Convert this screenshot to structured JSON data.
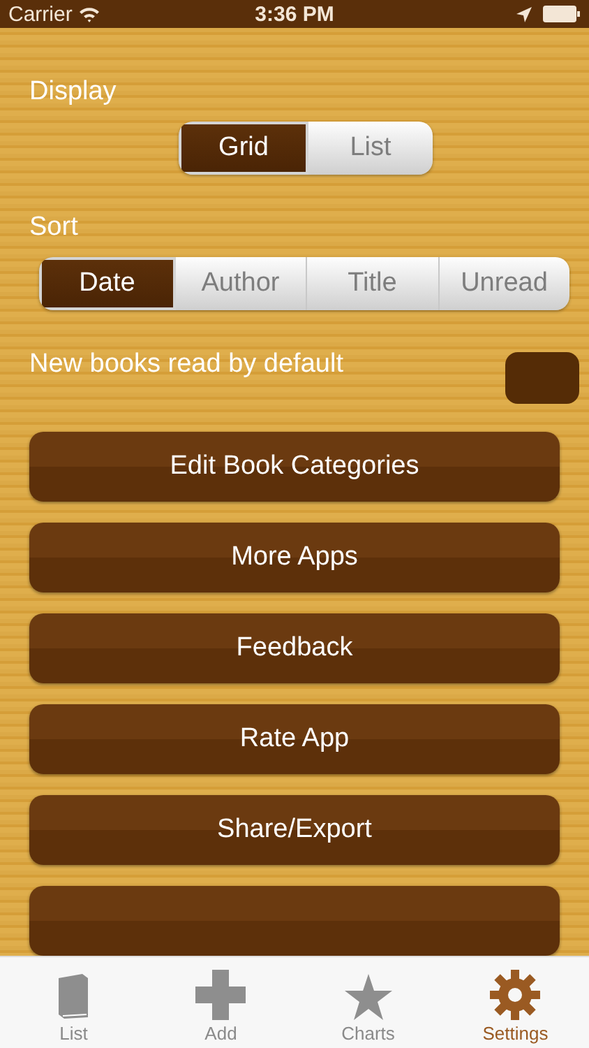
{
  "status_bar": {
    "carrier": "Carrier",
    "time": "3:36 PM"
  },
  "display": {
    "label": "Display",
    "options": [
      {
        "label": "Grid",
        "selected": true
      },
      {
        "label": "List",
        "selected": false
      }
    ]
  },
  "sort": {
    "label": "Sort",
    "options": [
      {
        "label": "Date",
        "selected": true
      },
      {
        "label": "Author",
        "selected": false
      },
      {
        "label": "Title",
        "selected": false
      },
      {
        "label": "Unread",
        "selected": false
      }
    ]
  },
  "setting": {
    "label": "New books read by default",
    "on": false
  },
  "buttons": [
    {
      "kind": "button",
      "label": "Edit Book Categories"
    },
    {
      "kind": "button",
      "label": "More Apps"
    },
    {
      "kind": "button",
      "label": "Feedback"
    },
    {
      "kind": "button",
      "label": "Rate App"
    },
    {
      "kind": "button",
      "label": "Share/Export"
    },
    {
      "kind": "cut_off"
    }
  ],
  "tabs": [
    {
      "label": "List",
      "kind": "book",
      "selected": false
    },
    {
      "label": "Add",
      "kind": "plus",
      "selected": false
    },
    {
      "label": "Charts",
      "kind": "star",
      "selected": false
    },
    {
      "label": "Settings",
      "kind": "gear",
      "selected": true
    }
  ]
}
